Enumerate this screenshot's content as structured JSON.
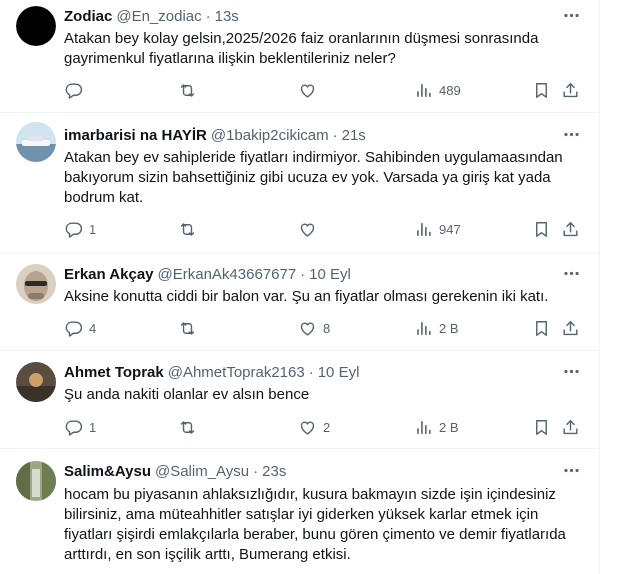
{
  "tweets": [
    {
      "name": "Zodiac",
      "handle": "@En_zodiac",
      "dot": "·",
      "time": "13s",
      "text": "Atakan bey kolay gelsin,2025/2026 faiz oranlarının düşmesi sonrasında gayrimenkul fiyatlarına ilişkin beklentileriniz neler?",
      "replies": "",
      "retweets": "",
      "likes": "",
      "views": "489",
      "avatar_color": "#000000"
    },
    {
      "name": "imarbarisi na HAYİR",
      "handle": "@1bakip2cikicam",
      "dot": "·",
      "time": "21s",
      "text": "Atakan bey ev sahipleride fiyatları indirmiyor. Sahibinden uygulamaasından bakıyorum sizin bahsettiğiniz gibi ucuza ev yok. Varsada ya giriş kat yada bodrum kat.",
      "replies": "1",
      "retweets": "",
      "likes": "",
      "views": "947",
      "avatar_color": "#cfe3f1"
    },
    {
      "name": "Erkan Akçay",
      "handle": "@ErkanAk43667677",
      "dot": "·",
      "time": "10 Eyl",
      "text": "Aksine konutta ciddi bir balon var. Şu an fiyatlar olması gerekenin iki katı.",
      "replies": "4",
      "retweets": "",
      "likes": "8",
      "views": "2 B",
      "avatar_color": "#b8a48a"
    },
    {
      "name": "Ahmet Toprak",
      "handle": "@AhmetToprak2163",
      "dot": "·",
      "time": "10 Eyl",
      "text": "Şu anda nakiti olanlar ev alsın bence",
      "replies": "1",
      "retweets": "",
      "likes": "2",
      "views": "2 B",
      "avatar_color": "#6a5a48"
    },
    {
      "name": "Salim&Aysu",
      "handle": "@Salim_Aysu",
      "dot": "·",
      "time": "23s",
      "text": "hocam bu piyasanın ahlaksızlığıdır, kusura bakmayın sizde işin içindesiniz bilirsiniz, ama müteahhitler satışlar iyi giderken yüksek karlar etmek için fiyatları şişirdi emlakçılarla beraber, bunu gören çimento ve demir fiyatlarıda arttırdı, en son işçilik arttı, Bumerang etkisi.",
      "replies": "",
      "retweets": "",
      "likes": "",
      "views": "",
      "avatar_color": "#7a8a5a"
    }
  ],
  "icons": {
    "more": "more-icon",
    "reply": "reply-icon",
    "retweet": "retweet-icon",
    "like": "like-icon",
    "views": "views-icon",
    "bookmark": "bookmark-icon",
    "share": "share-icon"
  },
  "colors": {
    "text": "#0f1419",
    "secondary": "#536471",
    "divider": "#eff3f4"
  }
}
